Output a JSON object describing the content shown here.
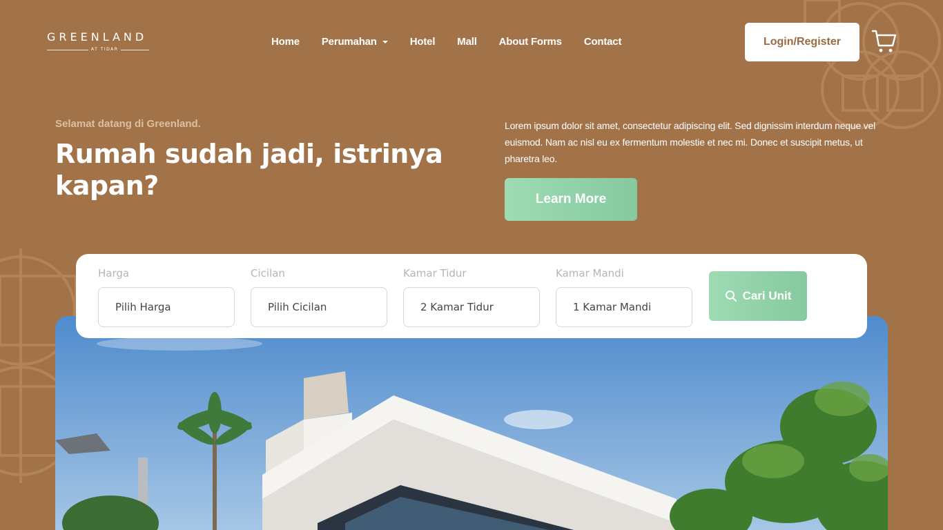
{
  "brand": {
    "name": "GREENLAND",
    "tagline": "AT TIDAR"
  },
  "nav": {
    "items": [
      {
        "label": "Home"
      },
      {
        "label": "Perumahan",
        "dropdown": true
      },
      {
        "label": "Hotel"
      },
      {
        "label": "Mall"
      },
      {
        "label": "About Forms"
      },
      {
        "label": "Contact"
      }
    ],
    "login_label": "Login/Register",
    "cart_icon": "cart-icon"
  },
  "hero": {
    "kicker": "Selamat datang di Greenland.",
    "title": "Rumah sudah jadi, istrinya kapan?",
    "description": "Lorem ipsum dolor sit amet, consectetur adipiscing elit. Sed dignissim interdum neque vel euismod. Nam ac nisl eu ex fermentum molestie et nec mi. Donec et suscipit metus, ut pharetra leo.",
    "cta_label": "Learn More"
  },
  "search": {
    "fields": [
      {
        "label": "Harga",
        "value": "Pilih Harga"
      },
      {
        "label": "Cicilan",
        "value": "Pilih Cicilan"
      },
      {
        "label": "Kamar Tidur",
        "value": "2 Kamar Tidur"
      },
      {
        "label": "Kamar Mandi",
        "value": "1 Kamar Mandi"
      }
    ],
    "button_label": "Cari Unit",
    "button_icon": "search-icon"
  },
  "colors": {
    "background": "#a27349",
    "accent_green": "#8fd0a6",
    "brand_brown": "#9a6b42"
  }
}
